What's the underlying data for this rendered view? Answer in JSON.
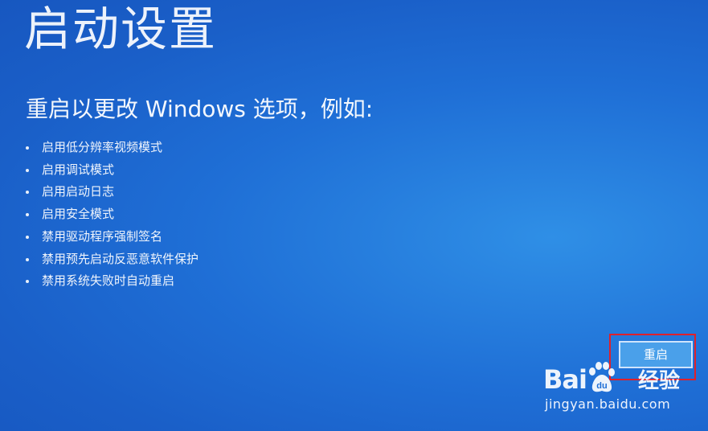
{
  "page": {
    "title": "启动设置",
    "subtitle": "重启以更改 Windows 选项，例如:"
  },
  "options": [
    "启用低分辨率视频模式",
    "启用调试模式",
    "启用启动日志",
    "启用安全模式",
    "禁用驱动程序强制签名",
    "禁用预先启动反恶意软件保护",
    "禁用系统失败时自动重启"
  ],
  "actions": {
    "restart_label": "重启"
  },
  "watermark": {
    "brand_left": "Bai",
    "brand_right": "经验",
    "url": "jingyan.baidu.com"
  },
  "colors": {
    "background": "#1f6fd6",
    "button": "#4aa0ea",
    "highlight": "#e0202a",
    "text": "#ffffff"
  },
  "icons": {
    "watermark_logo": "baidu-paw-icon"
  }
}
